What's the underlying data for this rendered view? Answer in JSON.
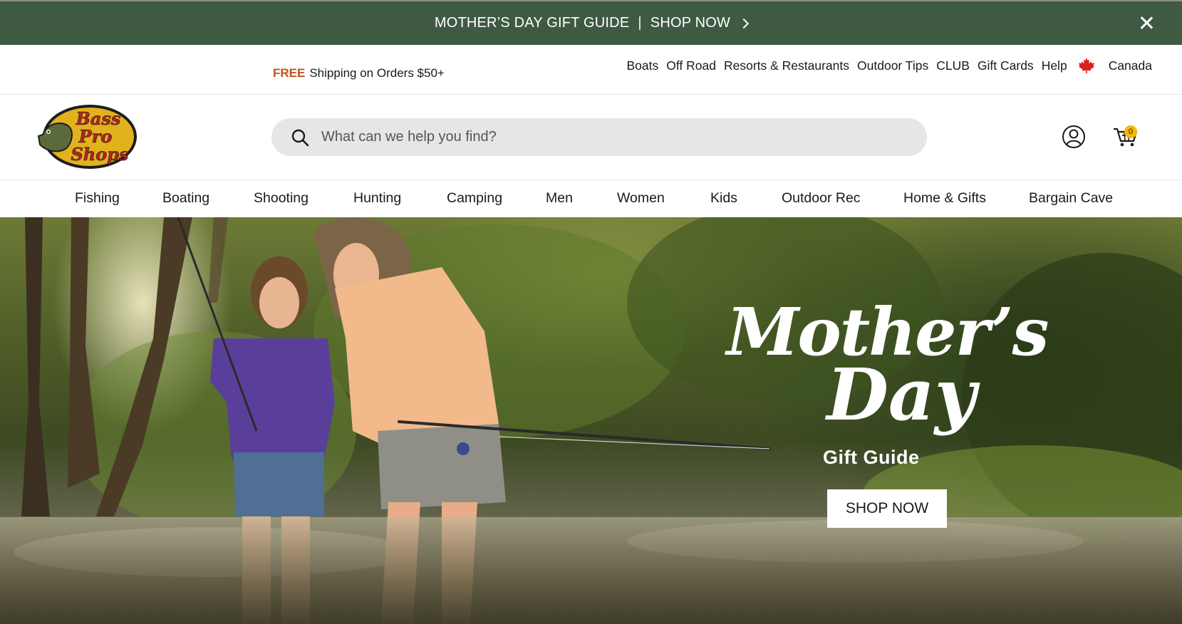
{
  "promo": {
    "text": "MOTHER’S DAY GIFT GUIDE",
    "separator": "|",
    "cta": "SHOP NOW",
    "background": "#3f5a43",
    "close_icon": "close-icon",
    "chevron_icon": "chevron-right-icon"
  },
  "utility": {
    "free_label": "FREE",
    "shipping_text": "Shipping on Orders $50+",
    "links": [
      "Boats",
      "Off Road",
      "Resorts & Restaurants",
      "Outdoor Tips",
      "CLUB",
      "Gift Cards",
      "Help"
    ],
    "country": "Canada",
    "country_icon": "maple-leaf-icon",
    "free_color": "#c4511c"
  },
  "header": {
    "logo_line1": "Bass",
    "logo_line2": "Pro",
    "logo_line3": "Shops",
    "search_placeholder": "What can we help you find?",
    "search_icon": "search-icon",
    "account_icon": "account-icon",
    "cart_icon": "cart-icon",
    "cart_count": "0"
  },
  "categories": [
    "Fishing",
    "Boating",
    "Shooting",
    "Hunting",
    "Camping",
    "Men",
    "Women",
    "Kids",
    "Outdoor Rec",
    "Home & Gifts",
    "Bargain Cave"
  ],
  "hero": {
    "title_line1": "Mother’s",
    "title_line2": "Day",
    "subtitle": "Gift Guide",
    "cta": "SHOP NOW"
  }
}
